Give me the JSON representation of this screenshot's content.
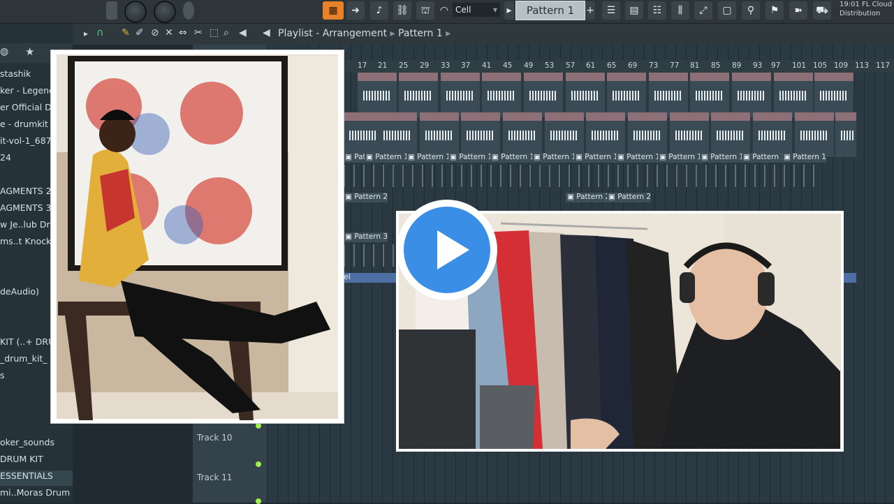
{
  "toolbar": {
    "cell_label": "Cell",
    "pattern_label": "Pattern 1",
    "pattern_plus": "+",
    "cloud_time": "19:01",
    "cloud_title": "FL Cloud",
    "cloud_sub": "Distribution"
  },
  "playlist": {
    "breadcrumb": "Playlist - Arrangement",
    "pattern_crumb": "Pattern 1",
    "ruler_ticks": [
      "17",
      "21",
      "25",
      "29",
      "33",
      "37",
      "41",
      "45",
      "49",
      "53",
      "57",
      "61",
      "65",
      "69",
      "73",
      "77",
      "81",
      "85",
      "89",
      "93",
      "97",
      "101",
      "105",
      "109",
      "113",
      "117"
    ],
    "track10": "Track 10",
    "track11": "Track 11",
    "clip_pattern1": "Pattern 1",
    "clip_pattern2": "Pattern 2",
    "clip_pattern3": "Pattern 3",
    "clip_el": "el"
  },
  "browser": {
    "items": [
      "stashik",
      "ker - Legend",
      "er Official Dru",
      "e - drumkit v",
      "it-vol-1_687",
      "24",
      "AGMENTS 2",
      "AGMENTS 3",
      "w Je..lub Dru",
      "ms..t Knock V",
      "deAudio)",
      "KIT (..+ DRUM",
      "_drum_kit_",
      "s",
      "oker_sounds",
      "DRUM KIT",
      "ESSENTIALS",
      "mi..Moras Drum Kit"
    ]
  },
  "colors": {
    "accent_orange": "#e8812a",
    "play_blue": "#3b8ee6",
    "green_led": "#9ef04a"
  }
}
